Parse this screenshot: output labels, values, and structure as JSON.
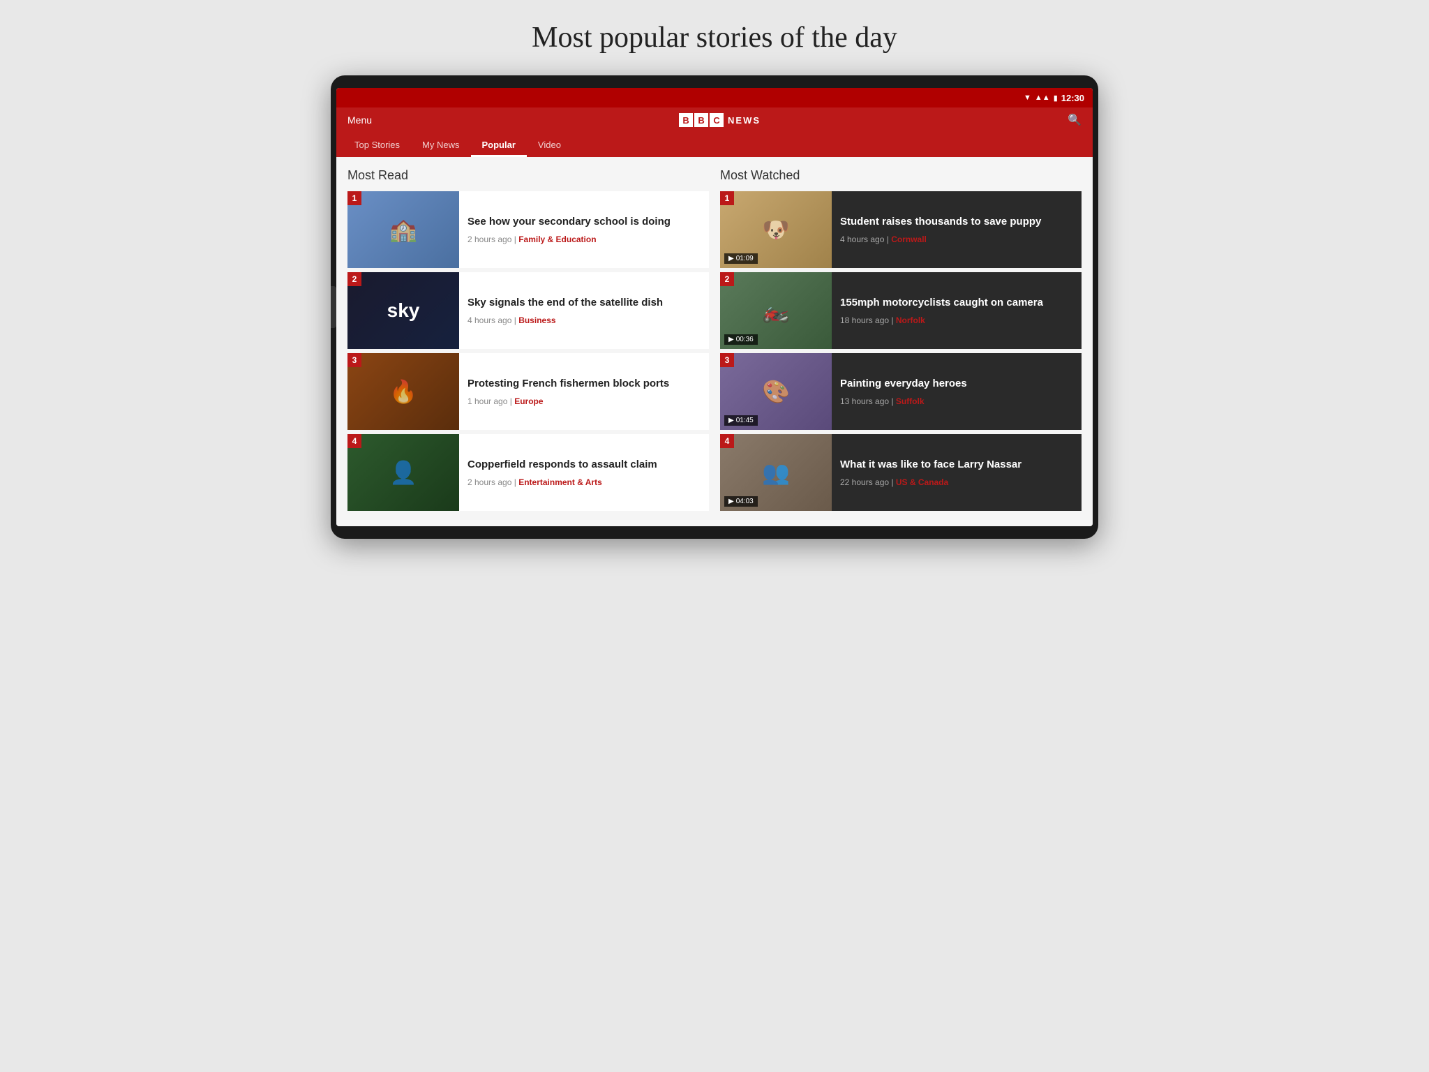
{
  "page": {
    "title": "Most popular stories of the day"
  },
  "status_bar": {
    "time": "12:30"
  },
  "header": {
    "menu_label": "Menu",
    "logo_blocks": [
      "B",
      "B",
      "C"
    ],
    "news_text": "NEWS"
  },
  "nav": {
    "tabs": [
      {
        "label": "Top Stories",
        "active": false
      },
      {
        "label": "My News",
        "active": false
      },
      {
        "label": "Popular",
        "active": true
      },
      {
        "label": "Video",
        "active": false
      }
    ]
  },
  "most_read": {
    "title": "Most Read",
    "items": [
      {
        "rank": "1",
        "title": "See how your secondary school is doing",
        "time_ago": "2 hours ago",
        "category": "Family & Education",
        "thumb_class": "thumb-school"
      },
      {
        "rank": "2",
        "title": "Sky signals the end of the satellite dish",
        "time_ago": "4 hours ago",
        "category": "Business",
        "thumb_class": "thumb-sky"
      },
      {
        "rank": "3",
        "title": "Protesting French fishermen block ports",
        "time_ago": "1 hour ago",
        "category": "Europe",
        "thumb_class": "thumb-fishermen"
      },
      {
        "rank": "4",
        "title": "Copperfield responds to assault claim",
        "time_ago": "2 hours ago",
        "category": "Entertainment & Arts",
        "thumb_class": "thumb-copperfield"
      }
    ]
  },
  "most_watched": {
    "title": "Most Watched",
    "items": [
      {
        "rank": "1",
        "title": "Student raises thousands to save puppy",
        "duration": "01:09",
        "time_ago": "4 hours ago",
        "category": "Cornwall",
        "thumb_class": "thumb-puppy"
      },
      {
        "rank": "2",
        "title": "155mph motorcyclists caught on camera",
        "duration": "00:36",
        "time_ago": "18 hours ago",
        "category": "Norfolk",
        "thumb_class": "thumb-motorcycles"
      },
      {
        "rank": "3",
        "title": "Painting everyday heroes",
        "duration": "01:45",
        "time_ago": "13 hours ago",
        "category": "Suffolk",
        "thumb_class": "thumb-painting"
      },
      {
        "rank": "4",
        "title": "What it was like to face Larry Nassar",
        "duration": "04:03",
        "time_ago": "22 hours ago",
        "category": "US & Canada",
        "thumb_class": "thumb-nassar"
      }
    ]
  }
}
